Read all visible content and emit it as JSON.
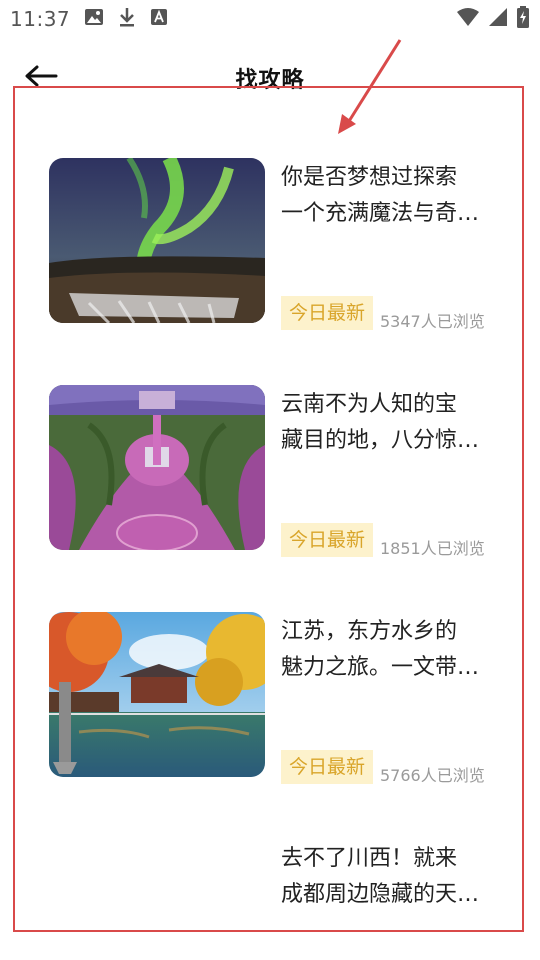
{
  "status_bar": {
    "time": "11:37",
    "left_icons": [
      "image-icon",
      "download-icon",
      "font-icon"
    ],
    "right_icons": [
      "wifi-icon",
      "signal-icon",
      "battery-charging-icon"
    ]
  },
  "header": {
    "title": "找攻略",
    "back_icon": "back-arrow-icon"
  },
  "articles": [
    {
      "title_line1": "你是否梦想过探索",
      "title_line2": "一个充满魔法与奇…",
      "tag": "今日最新",
      "views": "5347人已浏览",
      "image": "aurora-waterfall-photo"
    },
    {
      "title_line1": "云南不为人知的宝",
      "title_line2": "藏目的地，八分惊…",
      "tag": "今日最新",
      "views": "1851人已浏览",
      "image": "aerial-garden-photo"
    },
    {
      "title_line1": "江苏，东方水乡的",
      "title_line2": "魅力之旅。一文带…",
      "tag": "今日最新",
      "views": "5766人已浏览",
      "image": "autumn-pavilion-lake-photo"
    },
    {
      "title_line1": "去不了川西！就来",
      "title_line2": "成都周边隐藏的天…"
    }
  ],
  "colors": {
    "annotation": "#d94a4a",
    "tag_bg": "#fdf2cc",
    "tag_text": "#d9a52a",
    "views_text": "#9a9a9a"
  }
}
